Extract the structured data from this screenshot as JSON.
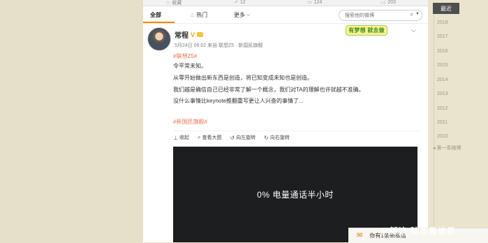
{
  "stats": [
    {
      "icon": "star-icon",
      "label": "收藏"
    },
    {
      "icon": "share-icon",
      "label": "12"
    },
    {
      "icon": "comment-icon",
      "label": "124"
    },
    {
      "icon": "like-icon",
      "label": "203"
    }
  ],
  "tabs": {
    "all": "全部",
    "hot": "热门",
    "more": "更多"
  },
  "search": {
    "placeholder": "搜索他的微博"
  },
  "post": {
    "user": "常程",
    "meta": "5月24日 06:02 来自 联想Z5 · 新国民旗舰",
    "sticker": "有梦想 就去做",
    "topic1": "#联想Z5#",
    "lines": [
      "令平常未知。",
      "从零开始做出新东西是创造，将已知变成未知也是创造。",
      "我们越是确信自己已经非常了解一个概念，我们对TA的理解也许就越不准确。",
      "没什么事情比keynote推翻重写更让人兴奋的事情了..."
    ],
    "topic2": "#新国民旗舰#",
    "actions": {
      "collapse": "收起",
      "view_large": "查看大图",
      "rotate_left": "向左旋转",
      "rotate_right": "向右旋转"
    },
    "video_text": "0%  电量通话半小时"
  },
  "timeline": {
    "current": "最近",
    "years": [
      "2018",
      "2017",
      "2016",
      "2015",
      "2014",
      "2013",
      "2012",
      "2011",
      "2010"
    ],
    "first_post": "第一条微博"
  },
  "notification": {
    "text": "你有1条新私信"
  },
  "watermark": "@新浪 陆杰看世界"
}
